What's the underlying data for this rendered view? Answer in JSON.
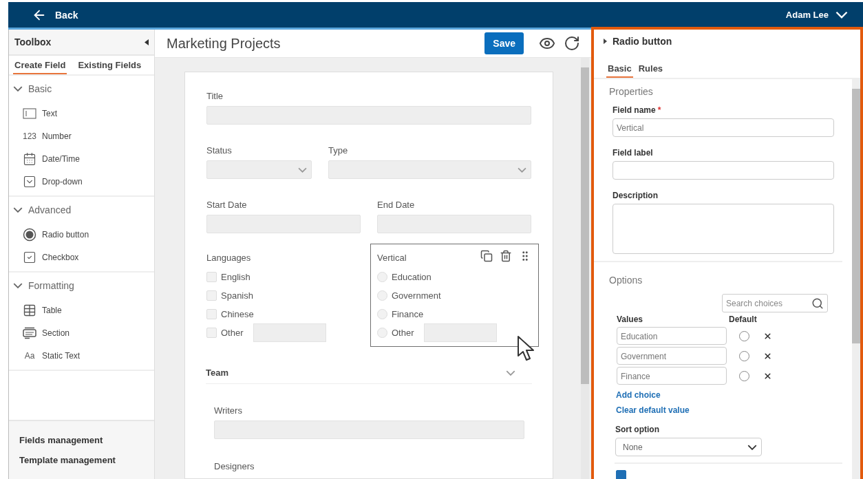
{
  "top_bar": {
    "back": "Back",
    "user": "Adam Lee"
  },
  "toolbox": {
    "title": "Toolbox",
    "tabs": [
      {
        "label": "Create Field",
        "selected": true
      },
      {
        "label": "Existing Fields",
        "selected": false
      }
    ],
    "groups": [
      {
        "label": "Basic",
        "expanded": true,
        "items": [
          {
            "kind": "text",
            "label": "Text"
          },
          {
            "kind": "number",
            "glyph": "123",
            "label": "Number"
          },
          {
            "kind": "datetime",
            "label": "Date/Time"
          },
          {
            "kind": "dropdown",
            "label": "Drop-down"
          }
        ]
      },
      {
        "label": "Advanced",
        "expanded": true,
        "items": [
          {
            "kind": "radio",
            "label": "Radio button"
          },
          {
            "kind": "checkbox",
            "label": "Checkbox"
          }
        ]
      },
      {
        "label": "Formatting",
        "expanded": true,
        "items": [
          {
            "kind": "table",
            "label": "Table"
          },
          {
            "kind": "section",
            "label": "Section"
          },
          {
            "kind": "static",
            "glyph": "Aa",
            "label": "Static Text"
          }
        ]
      }
    ],
    "footer_links": [
      "Fields management",
      "Template management"
    ]
  },
  "editor": {
    "title": "Marketing Projects",
    "save": "Save",
    "rows": [
      [
        {
          "kind": "text",
          "label": "Title"
        }
      ],
      [
        {
          "kind": "select",
          "label": "Status"
        },
        {
          "kind": "select",
          "label": "Type"
        }
      ],
      [
        {
          "kind": "text",
          "label": "Start Date"
        },
        {
          "kind": "text",
          "label": "End Date"
        }
      ],
      [
        {
          "kind": "checkbox-group",
          "label": "Languages",
          "options": [
            {
              "label": "English",
              "checked": false,
              "has_input": false
            },
            {
              "label": "Spanish",
              "checked": false,
              "has_input": false
            },
            {
              "label": "Chinese",
              "checked": false,
              "has_input": false
            },
            {
              "label": "Other",
              "checked": false,
              "has_input": true
            }
          ]
        },
        {
          "kind": "radio-group",
          "label": "Vertical",
          "selected": true,
          "options": [
            {
              "label": "Education",
              "selected": false,
              "has_input": false
            },
            {
              "label": "Government",
              "selected": false,
              "has_input": false
            },
            {
              "label": "Finance",
              "selected": false,
              "has_input": false
            },
            {
              "label": "Other",
              "selected": false,
              "has_input": true
            }
          ]
        }
      ],
      [
        {
          "kind": "section",
          "label": "Team",
          "expanded": true,
          "fields": [
            {
              "kind": "text",
              "label": "Writers"
            },
            {
              "kind": "label-only",
              "label": "Designers"
            }
          ]
        }
      ]
    ]
  },
  "properties_panel": {
    "title": "Radio button",
    "tabs": [
      {
        "label": "Basic",
        "selected": true
      },
      {
        "label": "Rules",
        "selected": false
      }
    ],
    "properties": {
      "heading": "Properties",
      "field_name": {
        "label": "Field name",
        "required_mark": "*",
        "value": "Vertical"
      },
      "field_label": {
        "label": "Field label"
      },
      "description": {
        "label": "Description"
      }
    },
    "options": {
      "heading": "Options",
      "search": {
        "placeholder": "Search choices"
      },
      "values_header": "Values",
      "default_header": "Default",
      "choices": [
        {
          "value": "Education",
          "default": false
        },
        {
          "value": "Government",
          "default": false
        },
        {
          "value": "Finance",
          "default": false
        }
      ],
      "add_choice": "Add choice",
      "clear_default": "Clear default value",
      "sort": {
        "label": "Sort option",
        "value": "None"
      },
      "next_checkbox": {
        "checked": true
      }
    }
  }
}
